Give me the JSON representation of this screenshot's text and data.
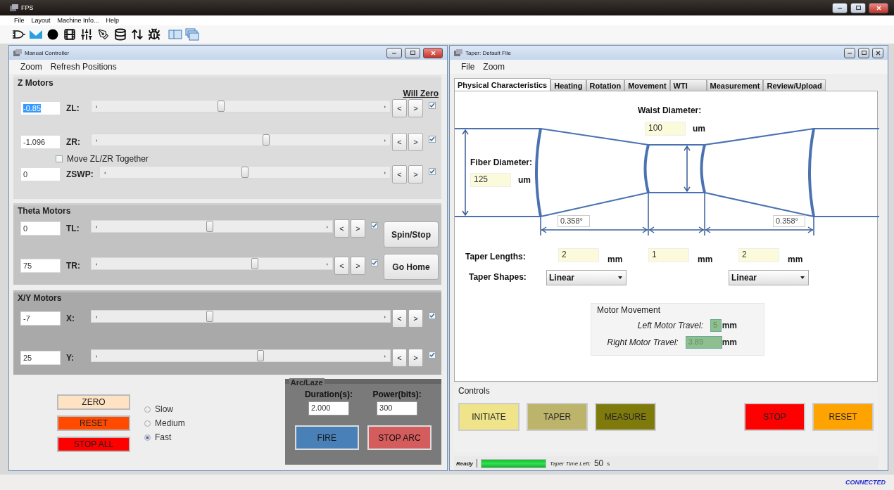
{
  "app": {
    "title": "FPS",
    "menu": [
      "File",
      "Layout",
      "Machine Info...",
      "Help"
    ],
    "connection": "CONNECTED"
  },
  "manual_controller": {
    "title": "Manual Controller",
    "menu": [
      "Zoom",
      "Refresh Positions"
    ],
    "z_motors": {
      "title": "Z Motors",
      "will_zero_label": "Will Zero",
      "rows": [
        {
          "kind": "motor",
          "value": "-0.85",
          "highlighted": true,
          "label": "ZL:",
          "level": 0.43,
          "buttons": [
            "<",
            ">"
          ],
          "will_zero": true
        },
        {
          "kind": "motor",
          "value": "-1.096",
          "highlighted": false,
          "label": "ZR:",
          "level": 0.59,
          "buttons": [
            "<",
            ">"
          ],
          "will_zero": true
        },
        {
          "kind": "toggle",
          "label": "Move ZL/ZR Together",
          "checked": false
        },
        {
          "kind": "motor",
          "value": "0",
          "highlighted": false,
          "label": "ZSWP:",
          "level": 0.5,
          "buttons": [
            "<",
            ">"
          ],
          "will_zero": true
        }
      ]
    },
    "theta_motors": {
      "title": "Theta Motors",
      "rows": [
        {
          "kind": "motor",
          "value": "0",
          "highlighted": false,
          "label": "TL:",
          "level": 0.49,
          "buttons": [
            "<",
            ">"
          ],
          "will_zero": true
        },
        {
          "kind": "motor",
          "value": "75",
          "highlighted": false,
          "label": "TR:",
          "level": 0.69,
          "buttons": [
            "<",
            ">"
          ],
          "will_zero": true
        }
      ],
      "side_buttons": [
        "Spin/Stop",
        "Go Home"
      ]
    },
    "xy_motors": {
      "title": "X/Y Motors",
      "rows": [
        {
          "kind": "motor",
          "value": "-7",
          "highlighted": false,
          "label": "X:",
          "level": 0.39,
          "buttons": [
            "<",
            ">"
          ],
          "will_zero": true
        },
        {
          "kind": "motor",
          "value": "25",
          "highlighted": false,
          "label": "Y:",
          "level": 0.57,
          "buttons": [
            "<",
            ">"
          ],
          "will_zero": true
        }
      ]
    },
    "actions": [
      {
        "label": "ZERO",
        "color": "#fde3c4"
      },
      {
        "label": "RESET",
        "color": "#ff4a00"
      },
      {
        "label": "STOP ALL",
        "color": "#ff0000"
      }
    ],
    "speed": [
      {
        "label": "Slow",
        "selected": false
      },
      {
        "label": "Medium",
        "selected": false
      },
      {
        "label": "Fast",
        "selected": true
      }
    ],
    "arc": {
      "title": "Arc/Laze",
      "fields": [
        {
          "label": "Duration(s):",
          "value": "2.000"
        },
        {
          "label": "Power(bits):",
          "value": "300"
        }
      ],
      "buttons": [
        {
          "label": "FIRE",
          "color": "#4a80b8"
        },
        {
          "label": "STOP ARC",
          "color": "#d45c5c"
        }
      ]
    }
  },
  "taper": {
    "title": "Taper: Default File",
    "menu": [
      "File",
      "Zoom"
    ],
    "tabs": [
      {
        "label": "Physical Characteristics",
        "selected": true
      },
      {
        "label": "Heating",
        "selected": false
      },
      {
        "label": "Rotation",
        "selected": false
      },
      {
        "label": "Movement",
        "selected": false
      },
      {
        "label": "WTI",
        "selected": false
      },
      {
        "label": "Measurement",
        "selected": false
      },
      {
        "label": "Review/Upload",
        "selected": false
      }
    ],
    "physical": {
      "waist": {
        "label": "Waist Diameter:",
        "value": "100",
        "unit": "um"
      },
      "fiber": {
        "label": "Fiber Diameter:",
        "value": "125",
        "unit": "um"
      },
      "angles": [
        "0.358°",
        "0.358°"
      ],
      "lengths": {
        "label": "Taper Lengths:",
        "fields": [
          {
            "value": "2",
            "unit": "mm"
          },
          {
            "value": "1",
            "unit": "mm"
          },
          {
            "value": "2",
            "unit": "mm"
          }
        ]
      },
      "shapes": {
        "label": "Taper Shapes:",
        "options": [
          "Linear",
          "Linear"
        ]
      },
      "motor_movement": {
        "title": "Motor Movement",
        "rows": [
          {
            "label": "Left Motor Travel:",
            "value": "5",
            "unit": "mm"
          },
          {
            "label": "Right Motor Travel:",
            "value": "3.89",
            "unit": "mm"
          }
        ]
      }
    },
    "controls": {
      "title": "Controls",
      "groups": [
        {
          "buttons": [
            {
              "label": "INITIATE",
              "color": "#efe48a"
            },
            {
              "label": "TAPER",
              "color": "#bdb46c"
            },
            {
              "label": "MEASURE",
              "color": "#7f7a0c"
            }
          ]
        },
        {
          "buttons": [
            {
              "label": "STOP",
              "color": "#ff0000"
            },
            {
              "label": "RESET",
              "color": "#ffa300"
            }
          ]
        }
      ]
    },
    "status": {
      "state": "Ready",
      "level": 1,
      "time_label": "Taper Time Left:",
      "time": "50",
      "unit": "s"
    }
  }
}
